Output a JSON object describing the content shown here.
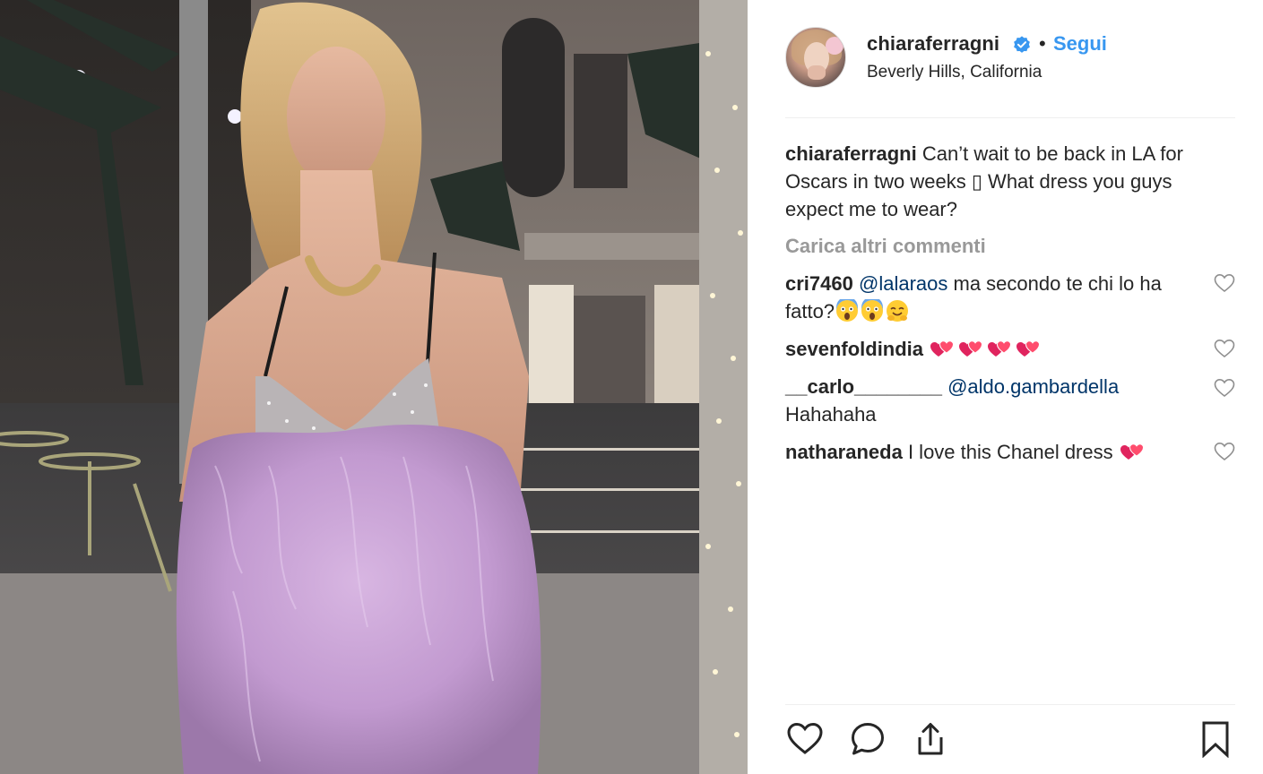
{
  "post": {
    "username": "chiaraferragni",
    "separator": "•",
    "follow_label": "Segui",
    "location": "Beverly Hills, California"
  },
  "caption": {
    "username": "chiaraferragni",
    "text": "Can’t wait to be back in LA for Oscars in two weeks ▯ What dress you guys expect me to wear?"
  },
  "load_more_label": "Carica altri commenti",
  "comments": [
    {
      "username": "cri7460",
      "mention": "@lalaraos",
      "text": "ma secondo te chi lo ha fatto?",
      "emojis": [
        "scream-emoji",
        "scream-emoji",
        "hugging-emoji"
      ]
    },
    {
      "username": "sevenfoldindia",
      "mention": "",
      "text": "",
      "emojis": [
        "two-hearts-emoji",
        "two-hearts-emoji",
        "two-hearts-emoji",
        "two-hearts-emoji"
      ]
    },
    {
      "username": "__carlo________",
      "mention": "@aldo.gambardella",
      "text": "Hahahaha",
      "emojis": []
    },
    {
      "username": "natharaneda",
      "mention": "",
      "text": "I love this Chanel dress",
      "emojis": [
        "two-hearts-emoji"
      ]
    }
  ],
  "colors": {
    "link_blue": "#3897f0",
    "mention_blue": "#003569",
    "muted_gray": "#999999",
    "text": "#262626",
    "dress_lilac": "#c9a3d6"
  },
  "icons": {
    "like": "heart-outline-icon",
    "comment": "speech-bubble-icon",
    "share": "share-upload-icon",
    "save": "bookmark-icon",
    "verified": "verified-badge-icon"
  }
}
